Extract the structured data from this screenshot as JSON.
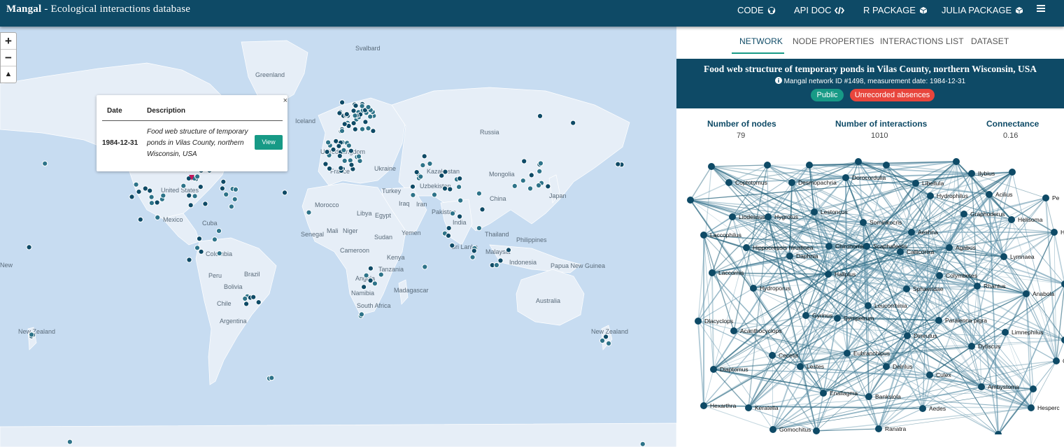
{
  "header": {
    "brand_name": "Mangal",
    "brand_rest": " - Ecological interactions database",
    "nav": [
      {
        "label": "CODE",
        "icon": "github-icon"
      },
      {
        "label": "API DOC",
        "icon": "code-icon"
      },
      {
        "label": "R PACKAGE",
        "icon": "package-icon"
      },
      {
        "label": "JULIA PACKAGE",
        "icon": "package-icon"
      }
    ],
    "menu_icon": "hamburger-menu-icon"
  },
  "map": {
    "zoom_in": "+",
    "zoom_out": "−",
    "reset_north": "▲",
    "labels": [
      "Svalbard",
      "Greenland",
      "Iceland",
      "Russia",
      "United Kingdom",
      "France",
      "Ukraine",
      "Kazakhstan",
      "Mongolia",
      "Uzbekistan",
      "Turkey",
      "China",
      "Japan",
      "Iraq",
      "Iran",
      "Pakistan",
      "Morocco",
      "Libya",
      "Egypt",
      "India",
      "Mali",
      "Niger",
      "Yemen",
      "Thailand",
      "Senegal",
      "Sudan",
      "Philippines",
      "Cameroon",
      "Sri Lanka",
      "Malaysia",
      "Kenya",
      "Indonesia",
      "Tanzania",
      "Papua New Guinea",
      "Angola",
      "Madagascar",
      "Namibia",
      "South Africa",
      "Australia",
      "New Zealand",
      "New Zealand",
      "United States",
      "Mexico",
      "Cuba",
      "Colombia",
      "Peru",
      "Brazil",
      "Bolivia",
      "Chile",
      "Argentina",
      "New"
    ],
    "popup": {
      "close": "×",
      "col_date": "Date",
      "col_desc": "Description",
      "date": "1984-12-31",
      "description": "Food web structure of temporary ponds in Vilas County, northern Wisconsin, USA",
      "view_button": "View"
    }
  },
  "panel": {
    "tabs": [
      "NETWORK",
      "NODE PROPERTIES",
      "INTERACTIONS LIST",
      "DATASET"
    ],
    "active_tab": "NETWORK",
    "title": "Food web structure of temporary ponds in Vilas County, northern Wisconsin, USA",
    "subtitle": "Mangal network ID #1498, measurement date: 1984-12-31",
    "info_icon": "info-icon",
    "badges": [
      {
        "label": "Public",
        "color": "#179a86"
      },
      {
        "label": "Unrecorded absences",
        "color": "#e8453c"
      }
    ],
    "stats": [
      {
        "label": "Number of nodes",
        "value": "79"
      },
      {
        "label": "Number of interactions",
        "value": "1010"
      },
      {
        "label": "Connectance",
        "value": "0.16"
      }
    ],
    "nodes": [
      "Coptotomus",
      "Desmopachria",
      "Dorocordulia",
      "Libellula",
      "Ilybius",
      "Acilius",
      "Pe",
      "Hydrophilus",
      "Graphoderus",
      "Helisoma",
      "Hy",
      "Laccophilus",
      "Liodessus",
      "Hygrotus",
      "Lestoncus",
      "Sominkocris",
      "Aeshna",
      "Agabus",
      "Hippocrepsis hirudinea",
      "Daphnia",
      "Chironomids",
      "Scaphafeetis",
      "Callicorixa",
      "Lymnaea",
      "Laccornis",
      "Hallplus",
      "Colymbetes",
      "Rhantus",
      "Hydroporus",
      "Sphaeridae",
      "Anabola",
      "Dlacyclops",
      "Gyrinus",
      "Sympetrum",
      "Leucorrhinia",
      "Paraleona pigra",
      "Acanthocyclops",
      "Limnephilus",
      "Dineutus",
      "Dytiscus",
      "Ge",
      "Cecetis",
      "Lestes",
      "Eubranchipus",
      "Delrilus",
      "Culex",
      "Diaptomus",
      "Ambystoma",
      "Enallagma",
      "Banksiola",
      "Hexarthra",
      "Keratella",
      "Aedes",
      "Hesperc",
      "Gomochitus",
      "Ranatra"
    ]
  }
}
